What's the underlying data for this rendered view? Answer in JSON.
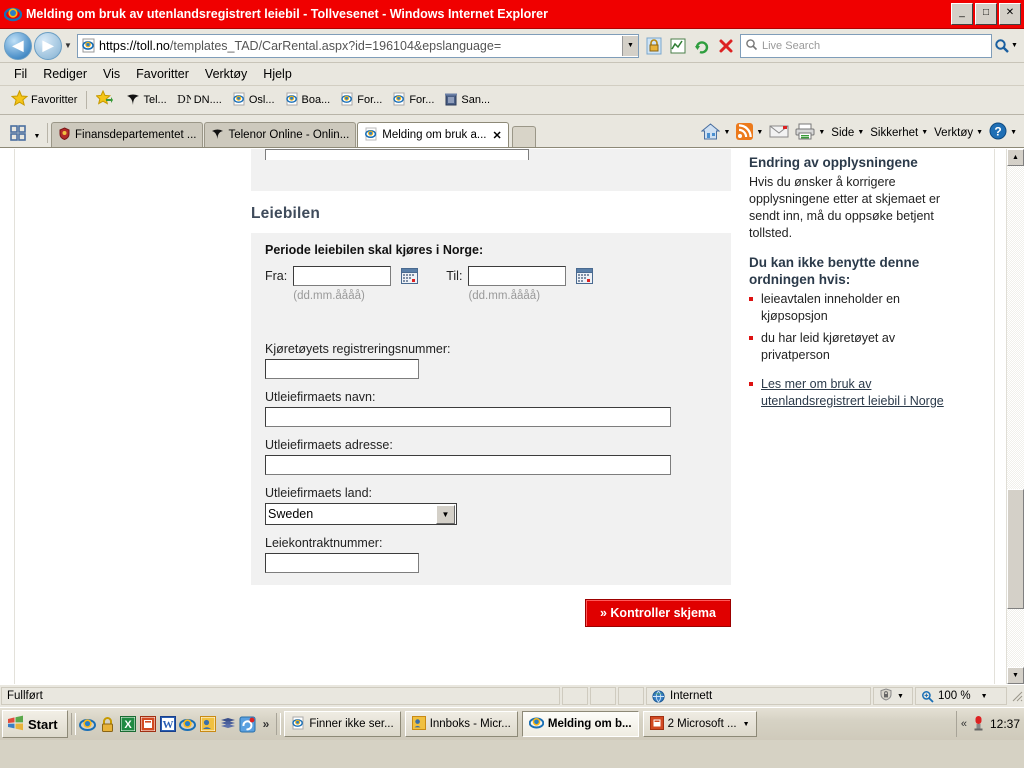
{
  "window": {
    "title": "Melding om bruk av utenlandsregistrert leiebil - Tollvesenet - Windows Internet Explorer",
    "minimize_label": "_",
    "maximize_label": "□",
    "close_label": "✕",
    "app_icon": "ie-logo-icon"
  },
  "addressbar": {
    "back_label": "◀",
    "forward_label": "▶",
    "history_dropdown_label": "▼",
    "url_scheme": "https://",
    "url_host": "toll.no",
    "url_path": "/templates_TAD/CarRental.aspx?id=196104&epslanguage=",
    "url_full": "https://toll.no/templates_TAD/CarRental.aspx?id=196104&epslanguage=",
    "url_dropdown_label": "▼",
    "icons": [
      "lock-icon",
      "compatibility-view-icon",
      "refresh-icon",
      "stop-icon"
    ],
    "search_placeholder": "Live Search",
    "search_icon": "search-icon",
    "search_go_icon": "search-go-icon",
    "search_go_dropdown": "▼"
  },
  "menubar": {
    "items": [
      {
        "label": "Fil"
      },
      {
        "label": "Rediger"
      },
      {
        "label": "Vis"
      },
      {
        "label": "Favoritter"
      },
      {
        "label": "Verktøy"
      },
      {
        "label": "Hjelp"
      }
    ]
  },
  "favoritesbar": {
    "button_label": "Favoritter",
    "button_icon": "star-icon",
    "add_icon": "add-favorite-icon",
    "items": [
      {
        "label": "Tel...",
        "icon": "telenor-icon"
      },
      {
        "label": "DN....",
        "icon": "dn-icon"
      },
      {
        "label": "Osl...",
        "icon": "ie-page-icon"
      },
      {
        "label": "Boa...",
        "icon": "ie-page-icon"
      },
      {
        "label": "For...",
        "icon": "ie-page-icon"
      },
      {
        "label": "For...",
        "icon": "ie-page-icon"
      },
      {
        "label": "San...",
        "icon": "trash-icon"
      }
    ]
  },
  "tabbar": {
    "quicktabs_icon": "quick-tabs-icon",
    "tablist_dropdown": "▼",
    "tabs": [
      {
        "label": "Finansdepartementet ...",
        "icon": "shield-icon",
        "active": false
      },
      {
        "label": "Telenor Online - Onlin...",
        "icon": "telenor-icon",
        "active": false
      },
      {
        "label": "Melding om bruk a...",
        "icon": "ie-page-icon",
        "active": true,
        "close_label": "✕"
      }
    ],
    "commands": [
      {
        "label": "",
        "icon": "home-icon",
        "dropdown": "▼"
      },
      {
        "label": "",
        "icon": "rss-icon",
        "dropdown": "▼"
      },
      {
        "label": "",
        "icon": "mail-icon",
        "dropdown": ""
      },
      {
        "label": "",
        "icon": "print-icon",
        "dropdown": "▼"
      },
      {
        "label": "Side",
        "icon": "",
        "dropdown": "▼"
      },
      {
        "label": "Sikkerhet",
        "icon": "",
        "dropdown": "▼"
      },
      {
        "label": "Verktøy",
        "icon": "",
        "dropdown": "▼"
      },
      {
        "label": "",
        "icon": "help-icon",
        "dropdown": "▼"
      }
    ]
  },
  "page": {
    "section_heading": "Leiebilen",
    "period_label": "Periode leiebilen skal kjøres i Norge:",
    "from_label": "Fra:",
    "from_value": "",
    "from_hint": "(dd.mm.åååå)",
    "from_calendar_icon": "calendar-icon",
    "to_label": "Til:",
    "to_value": "",
    "to_hint": "(dd.mm.åååå)",
    "to_calendar_icon": "calendar-icon",
    "fields": [
      {
        "label": "Kjøretøyets registreringsnummer:",
        "value": "",
        "name": "registration-number"
      },
      {
        "label": "Utleiefirmaets navn:",
        "value": "",
        "name": "rental-company-name"
      },
      {
        "label": "Utleiefirmaets adresse:",
        "value": "",
        "name": "rental-company-address"
      }
    ],
    "country_label": "Utleiefirmaets land:",
    "country_value": "Sweden",
    "country_options": [
      "Sweden"
    ],
    "contract_label": "Leiekontraktnummer:",
    "contract_value": "",
    "submit_label": "» Kontroller skjema"
  },
  "sidebar": {
    "heading1": "Endring av opplysningene",
    "paragraph1": "Hvis du ønsker å korrigere opplysningene etter at skjemaet er sendt inn, må du oppsøke betjent tollsted.",
    "heading2": "Du kan ikke benytte denne ordningen hvis:",
    "bullets": [
      "leieavtalen inneholder en kjøpsopsjon",
      "du har leid kjøretøyet av privatperson"
    ],
    "link_text": "Les mer om bruk av utenlandsregistrert leiebil i Norge"
  },
  "scrollbar": {
    "up_label": "▲",
    "down_label": "▼"
  },
  "statusbar": {
    "status_text": "Fullført",
    "zone_label": "Internett",
    "zone_icon": "globe-icon",
    "protected_icon": "protected-mode-icon",
    "protected_dropdown": "▼",
    "zoom_icon": "zoom-icon",
    "zoom_label": "100 %",
    "zoom_dropdown": "▼"
  },
  "taskbar": {
    "start_label": "Start",
    "start_icon": "windows-flag-icon",
    "quicklaunch": [
      {
        "icon": "ie-icon"
      },
      {
        "icon": "lock-icon"
      },
      {
        "icon": "excel-icon"
      },
      {
        "icon": "powerpoint-icon"
      },
      {
        "icon": "word-icon"
      },
      {
        "icon": "ie-icon"
      },
      {
        "icon": "outlook-icon"
      },
      {
        "icon": "book-icon"
      },
      {
        "icon": "sync-icon"
      }
    ],
    "quicklaunch_more": "»",
    "tasks": [
      {
        "label": "Finner ikke ser...",
        "icon": "ie-page-icon",
        "active": false
      },
      {
        "label": "Innboks - Micr...",
        "icon": "outlook-icon",
        "active": false
      },
      {
        "label": "Melding om b...",
        "icon": "ie-icon",
        "active": true
      },
      {
        "label": "2 Microsoft ...",
        "icon": "powerpoint-icon",
        "active": false,
        "dropdown": "▼"
      }
    ],
    "tray_chevron": "«",
    "tray_icon": "usb-icon",
    "clock": "12:37"
  },
  "colors": {
    "titlebar": "#f00000",
    "accent_red": "#e00000",
    "heading_blue": "#3f4b5b",
    "chrome": "#e9e7df"
  }
}
